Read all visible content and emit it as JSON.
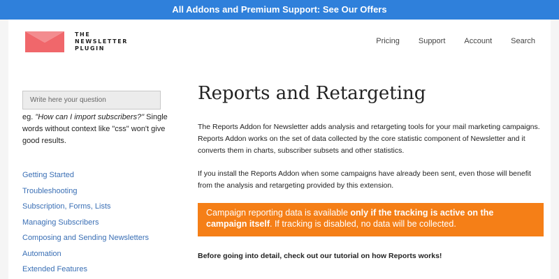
{
  "banner": {
    "text": "All Addons and Premium Support: See Our Offers"
  },
  "logo": {
    "line1": "THE NEWSLETTER",
    "line2": "PLUGIN",
    "icon": "envelope-logo-icon",
    "color": "#f0676b"
  },
  "nav": {
    "items": [
      "Pricing",
      "Support",
      "Account",
      "Search"
    ]
  },
  "search": {
    "placeholder": "Write here your question",
    "hint_prefix": "eg. ",
    "hint_example": "\"How can I import subscribers?\"",
    "hint_suffix": " Single words without context like \"css\" won't give good results."
  },
  "sidebar": {
    "items": [
      "Getting Started",
      "Troubleshooting",
      "Subscription, Forms, Lists",
      "Managing Subscribers",
      "Composing and Sending Newsletters",
      "Automation",
      "Extended Features"
    ]
  },
  "main": {
    "title": "Reports and Retargeting",
    "para1": "The Reports Addon for Newsletter adds analysis and retargeting tools for your mail marketing campaigns. Reports Addon works on the set of data collected by the core statistic component of Newsletter and it converts them in charts, subscriber subsets and other statistics.",
    "para2": "If you install the Reports Addon when some campaigns have already been sent, even those will benefit from the analysis and retargeting provided by this extension.",
    "notice_prefix": "Campaign reporting data is available ",
    "notice_bold": "only if the tracking is active on the campaign itself",
    "notice_suffix": ". If tracking is disabled, no data will be collected.",
    "tutorial": "Before going into detail, check out our tutorial on how Reports works!"
  },
  "colors": {
    "banner": "#2f80db",
    "notice": "#f57f17",
    "link": "#3a6fb5"
  }
}
